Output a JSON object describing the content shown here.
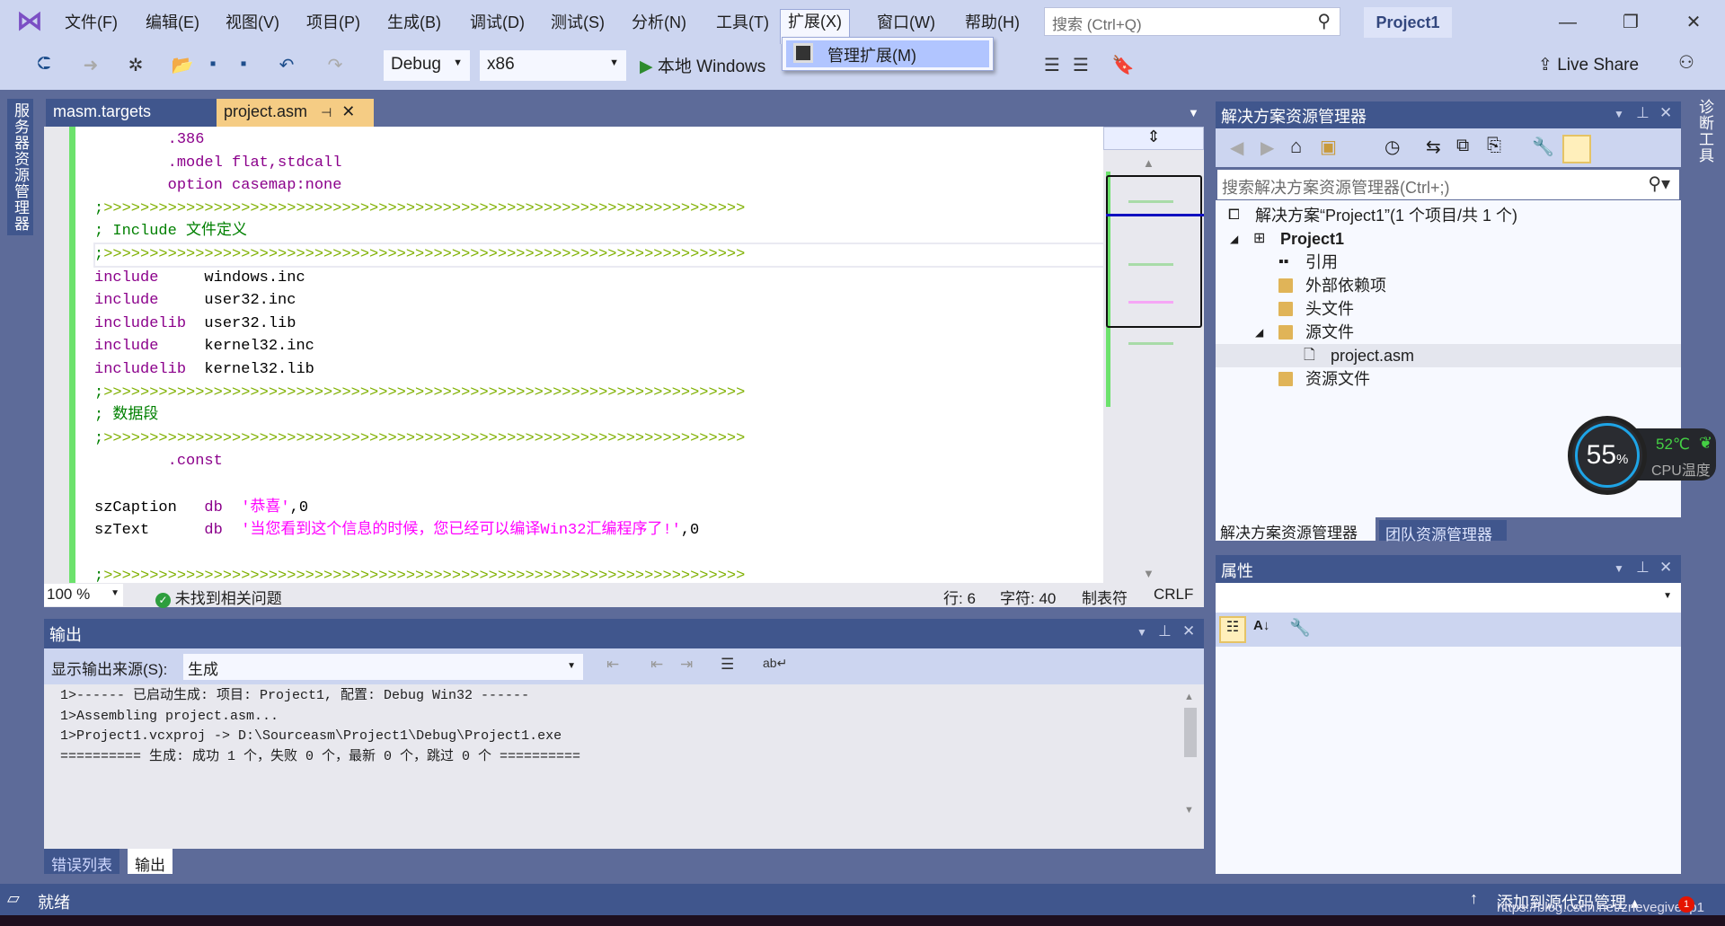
{
  "app": {
    "title": "Project1",
    "logo": "visual-studio-logo"
  },
  "menu": [
    "文件(F)",
    "编辑(E)",
    "视图(V)",
    "项目(P)",
    "生成(B)",
    "调试(D)",
    "测试(S)",
    "分析(N)",
    "工具(T)",
    "扩展(X)",
    "窗口(W)",
    "帮助(H)"
  ],
  "open_menu": {
    "label": "扩展(X)",
    "items": [
      "管理扩展(M)"
    ]
  },
  "search": {
    "placeholder": "搜索 (Ctrl+Q)"
  },
  "toolbar": {
    "config": "Debug",
    "platform": "x86",
    "run_label": "本地 Windows",
    "live_share": "Live Share"
  },
  "left_strip": "服务器资源管理器",
  "right_strip": "诊断工具",
  "tabs": [
    {
      "label": "masm.targets",
      "active": false
    },
    {
      "label": "project.asm",
      "active": true
    }
  ],
  "accent": {
    "active_tab": "#f5cc84",
    "chrome": "#ccd5f0",
    "dark": "#40568d",
    "changebar": "#6ce26c"
  },
  "code": [
    [
      [
        "        ",
        ""
      ],
      [
        ".386",
        "dir"
      ]
    ],
    [
      [
        "        ",
        ""
      ],
      [
        ".model flat,stdcall",
        "dir"
      ]
    ],
    [
      [
        "        ",
        ""
      ],
      [
        "option casemap:none",
        "dir"
      ]
    ],
    [
      [
        ";",
        "cm"
      ],
      [
        ">>>>>>>>>>>>>>>>>>>>>>>>>>>>>>>>>>>>>>>>>>>>>>>>>>>>>>>>>>>>>>>>>>>>>>",
        "arr"
      ]
    ],
    [
      [
        "; Include 文件定义",
        "cm"
      ]
    ],
    [
      [
        ";",
        "cm"
      ],
      [
        ">>>>>>>>>>>>>>>>>>>>>>>>>>>>>>>>>>>>>>>>>>>>>>>>>>>>>>>>>>>>>>>>>>>>>>",
        "arr"
      ]
    ],
    [
      [
        "include",
        "dir"
      ],
      [
        "     windows.inc",
        "id"
      ]
    ],
    [
      [
        "include",
        "dir"
      ],
      [
        "     user32.inc",
        "id"
      ]
    ],
    [
      [
        "includelib",
        "dir"
      ],
      [
        "  user32.lib",
        "id"
      ]
    ],
    [
      [
        "include",
        "dir"
      ],
      [
        "     kernel32.inc",
        "id"
      ]
    ],
    [
      [
        "includelib",
        "dir"
      ],
      [
        "  kernel32.lib",
        "id"
      ]
    ],
    [
      [
        ";",
        "cm"
      ],
      [
        ">>>>>>>>>>>>>>>>>>>>>>>>>>>>>>>>>>>>>>>>>>>>>>>>>>>>>>>>>>>>>>>>>>>>>>",
        "arr"
      ]
    ],
    [
      [
        "; 数据段",
        "cm"
      ]
    ],
    [
      [
        ";",
        "cm"
      ],
      [
        ">>>>>>>>>>>>>>>>>>>>>>>>>>>>>>>>>>>>>>>>>>>>>>>>>>>>>>>>>>>>>>>>>>>>>>",
        "arr"
      ]
    ],
    [
      [
        "        ",
        ""
      ],
      [
        ".const",
        "dir"
      ]
    ],
    [],
    [
      [
        "szCaption   ",
        "id"
      ],
      [
        "db",
        "kw"
      ],
      [
        "  ",
        ""
      ],
      [
        "'恭喜'",
        "str"
      ],
      [
        ",0",
        "id"
      ]
    ],
    [
      [
        "szText      ",
        "id"
      ],
      [
        "db",
        "kw"
      ],
      [
        "  ",
        ""
      ],
      [
        "'当您看到这个信息的时候，您已经可以编译Win32汇编程序了!'",
        "str"
      ],
      [
        ",0",
        "id"
      ]
    ],
    [],
    [
      [
        ";",
        "cm"
      ],
      [
        ">>>>>>>>>>>>>>>>>>>>>>>>>>>>>>>>>>>>>>>>>>>>>>>>>>>>>>>>>>>>>>>>>>>>>>",
        "arr"
      ]
    ]
  ],
  "current_line_index": 5,
  "editor_status": {
    "zoom": "100 %",
    "issues": "未找到相关问题",
    "line": "行: 6",
    "char": "字符: 40",
    "tabs": "制表符",
    "eol": "CRLF"
  },
  "output": {
    "title": "输出",
    "source_label": "显示输出来源(S):",
    "source_value": "生成",
    "lines": [
      "1>------ 已启动生成: 项目: Project1, 配置: Debug Win32 ------",
      "1>Assembling project.asm...",
      "1>Project1.vcxproj -> D:\\Sourceasm\\Project1\\Debug\\Project1.exe",
      "========== 生成: 成功 1 个，失败 0 个，最新 0 个，跳过 0 个 =========="
    ]
  },
  "bottom_tabs": [
    {
      "label": "错误列表",
      "active": false
    },
    {
      "label": "输出",
      "active": true
    }
  ],
  "solution_explorer": {
    "title": "解决方案资源管理器",
    "search_placeholder": "搜索解决方案资源管理器(Ctrl+;)",
    "tree": [
      {
        "label": "解决方案“Project1”(1 个项目/共 1 个)",
        "icon": "solution-icon"
      },
      {
        "label": "Project1",
        "icon": "project-icon",
        "bold": true,
        "expanded": true
      },
      {
        "label": "引用",
        "icon": "references-icon"
      },
      {
        "label": "外部依赖项",
        "icon": "external-deps-icon"
      },
      {
        "label": "头文件",
        "icon": "folder-icon"
      },
      {
        "label": "源文件",
        "icon": "folder-icon",
        "expanded": true
      },
      {
        "label": "project.asm",
        "icon": "file-icon",
        "selected": true
      },
      {
        "label": "资源文件",
        "icon": "folder-icon"
      }
    ],
    "tabs": [
      {
        "label": "解决方案资源管理器",
        "active": true
      },
      {
        "label": "团队资源管理器",
        "active": false
      }
    ]
  },
  "properties": {
    "title": "属性"
  },
  "cpu_widget": {
    "usage": "55",
    "unit": "%",
    "temp": "52℃",
    "label": "CPU温度"
  },
  "statusbar": {
    "ready": "就绪",
    "source_control": "添加到源代码管理",
    "watermark": "https://blog.csdn.net/znevegiveup1",
    "notifications": "1"
  }
}
